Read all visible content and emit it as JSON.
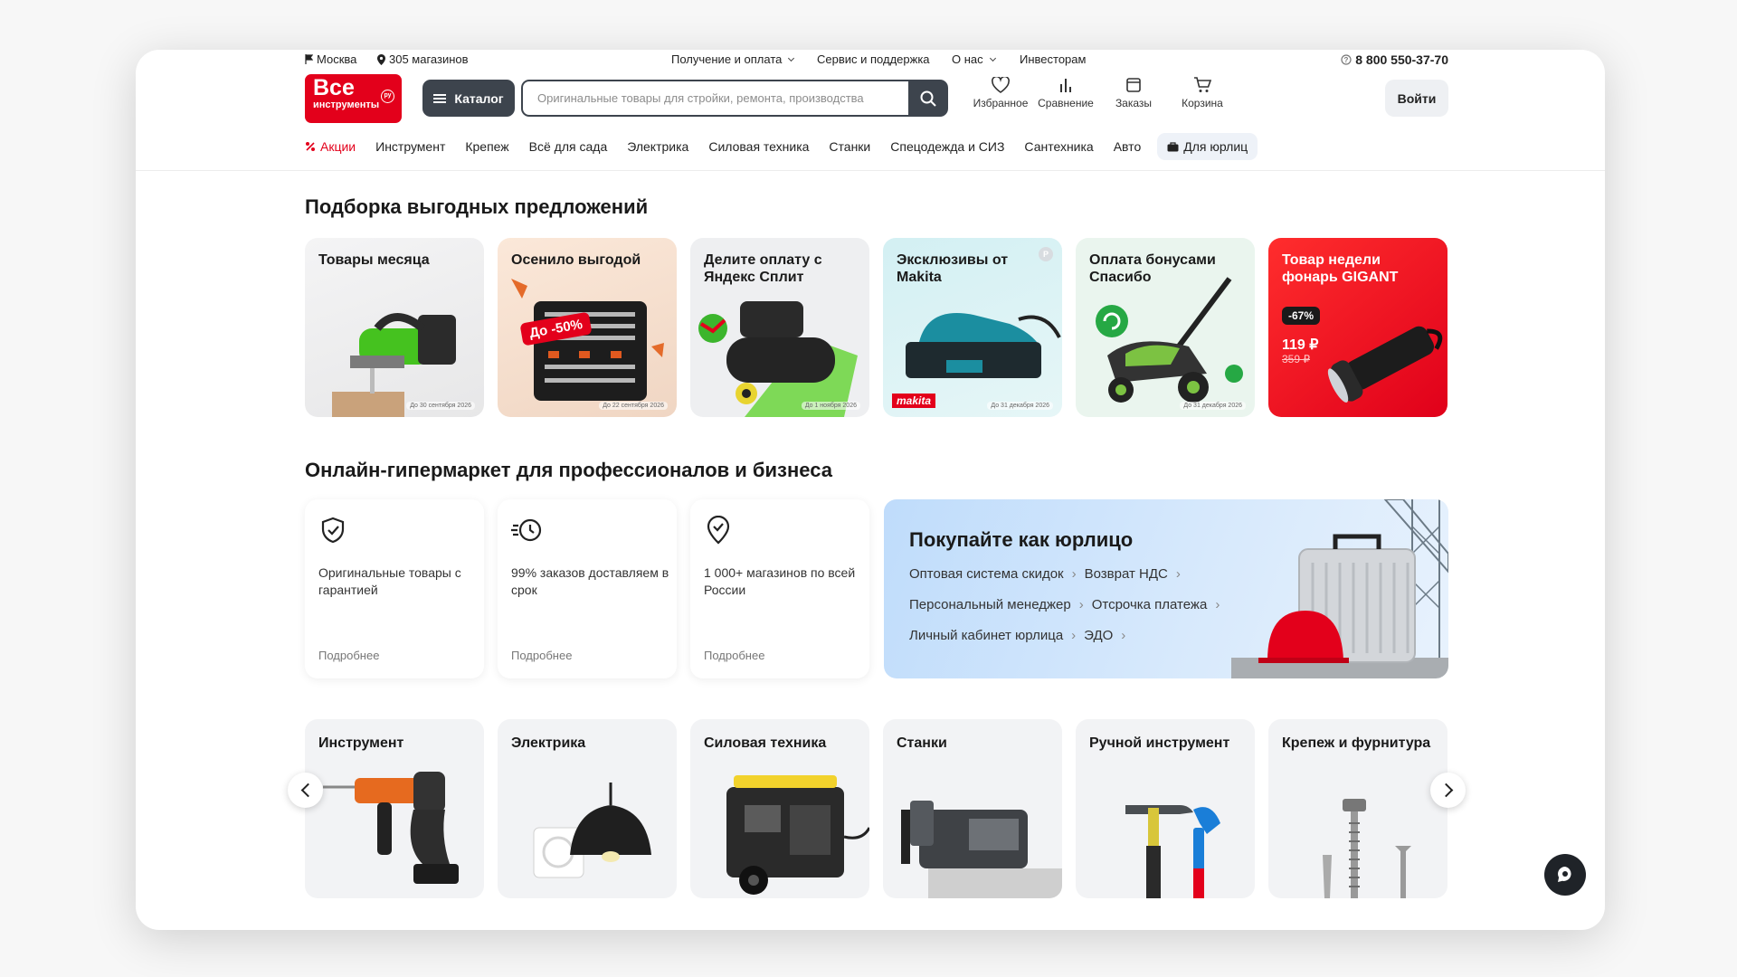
{
  "top": {
    "city": "Москва",
    "stores": "305 магазинов",
    "links": [
      "Получение и оплата",
      "Сервис и поддержка",
      "О нас",
      "Инвесторам"
    ],
    "phone": "8 800 550-37-70"
  },
  "logo": {
    "line1": "Все",
    "line2": "инструменты",
    "badge": "ру"
  },
  "header": {
    "catalog": "Каталог",
    "search_placeholder": "Оригинальные товары для стройки, ремонта, производства",
    "favorites": "Избранное",
    "compare": "Сравнение",
    "orders": "Заказы",
    "cart": "Корзина",
    "login": "Войти"
  },
  "nav": [
    "Акции",
    "Инструмент",
    "Крепеж",
    "Всё для сада",
    "Электрика",
    "Силовая техника",
    "Станки",
    "Спецодежда и СИЗ",
    "Сантехника",
    "Авто",
    "Для юрлиц"
  ],
  "offers": {
    "title": "Подборка выгодных предложений",
    "cards": [
      {
        "title": "Товары месяца",
        "date": "До 30 сентября 2026"
      },
      {
        "title": "Осенило выгодой",
        "badge": "До -50%",
        "date": "До 22 сентября 2026"
      },
      {
        "title": "Делите оплату с Яндекс Сплит",
        "date": "До 1 ноября 2026"
      },
      {
        "title": "Эксклюзивы от Makita",
        "date": "До 31 декабря 2026",
        "brand": "makita",
        "corner": "Р"
      },
      {
        "title": "Оплата бонусами Спасибо",
        "date": "До 31 декабря 2026"
      },
      {
        "title": "Товар недели фонарь GIGANT",
        "discount": "-67%",
        "price": "119 ₽",
        "old_price": "359 ₽"
      }
    ]
  },
  "business": {
    "title": "Онлайн-гипермаркет для профессионалов и бизнеса",
    "cards": [
      {
        "text": "Оригинальные товары с гарантией",
        "more": "Подробнее"
      },
      {
        "text": "99% заказов доставляем в срок",
        "more": "Подробнее"
      },
      {
        "text": "1 000+ магазинов по всей России",
        "more": "Подробнее"
      }
    ],
    "banner": {
      "title": "Покупайте как юрлицо",
      "rows": [
        [
          "Оптовая система скидок",
          "Возврат НДС"
        ],
        [
          "Персональный менеджер",
          "Отсрочка платежа"
        ],
        [
          "Личный кабинет юрлица",
          "ЭДО"
        ]
      ]
    }
  },
  "categories": [
    "Инструмент",
    "Электрика",
    "Силовая техника",
    "Станки",
    "Ручной инструмент",
    "Крепеж и фурнитура"
  ],
  "colors": {
    "brand": "#e3001b",
    "dark": "#3d444d"
  }
}
